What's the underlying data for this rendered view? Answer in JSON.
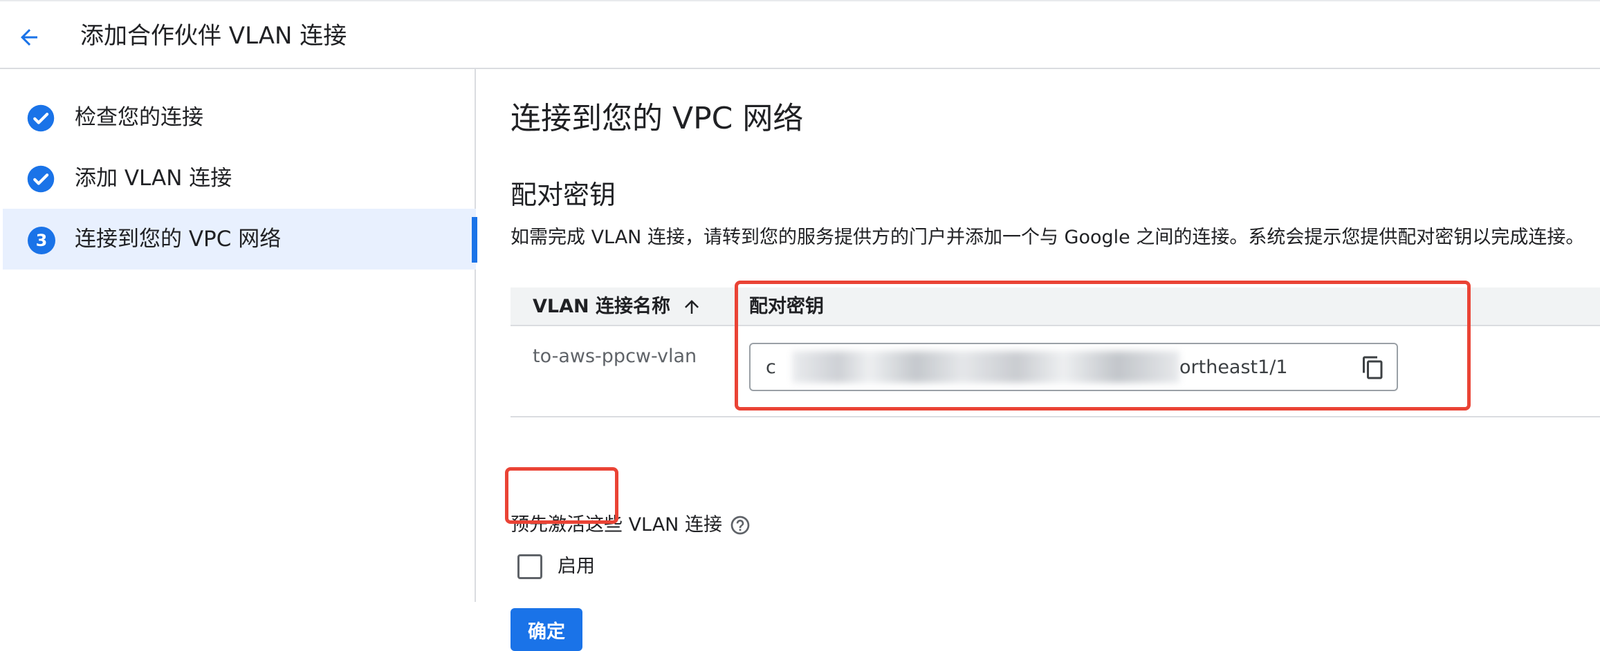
{
  "header": {
    "title": "添加合作伙伴 VLAN 连接",
    "back_icon": "arrow-back-icon"
  },
  "sidebar": {
    "steps": [
      {
        "label": "检查您的连接",
        "state": "done",
        "icon": "check-circle-icon"
      },
      {
        "label": "添加 VLAN 连接",
        "state": "done",
        "icon": "check-circle-icon"
      },
      {
        "label": "连接到您的 VPC 网络",
        "state": "current",
        "number": "3"
      }
    ]
  },
  "main": {
    "section_title": "连接到您的 VPC 网络",
    "subtitle": "配对密钥",
    "description": "如需完成 VLAN 连接，请转到您的服务提供方的门户并添加一个与 Google 之间的连接。系统会提示您提供配对密钥以完成连接。",
    "table": {
      "columns": [
        "VLAN 连接名称",
        "配对密钥"
      ],
      "sort_icon": "arrow-up-icon",
      "rows": [
        {
          "name": "to-aws-ppcw-vlan",
          "key_prefix": "c",
          "key_suffix": "ortheast1/1",
          "key_blurred": true
        }
      ],
      "copy_icon": "copy-icon"
    },
    "preactivate": {
      "label": "预先激活这些 VLAN 连接",
      "help_icon": "help-circle-icon",
      "checkbox_label": "启用",
      "checked": false
    },
    "confirm_label": "确定"
  },
  "colors": {
    "accent": "#1a73e8",
    "highlight": "#ea4335",
    "active_step_bg": "#e8f0fe"
  }
}
